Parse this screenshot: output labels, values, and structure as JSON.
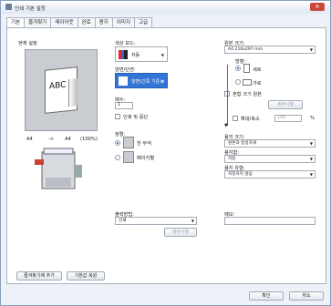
{
  "window": {
    "title": "인쇄 기본 설정",
    "close_label": "✕"
  },
  "tabs": [
    "기본",
    "즐겨찾기",
    "레이아웃",
    "완료",
    "용지",
    "이미지",
    "고급"
  ],
  "left": {
    "current_settings_label": "현재 설정",
    "preview_text": "ABC",
    "paper_row": {
      "from": "A4",
      "arrow": "->",
      "to": "A4",
      "zoom": "(100%)"
    }
  },
  "mid": {
    "color_mode_label": "색상 모드:",
    "color_mode_value": "자동",
    "duplex_label": "양면/단면:",
    "duplex_value": "양면(긴쪽 기준)",
    "copies_label": "매수:",
    "copies_value": "1",
    "collate_label": "인쇄 및 중단",
    "collate_sort_label": "정렬:",
    "collate_opt1": "한 부씩",
    "collate_opt2": "페이지별",
    "output_label": "출력방법:",
    "output_value": "인쇄",
    "detail_button": "세부사항"
  },
  "right": {
    "orig_size_label": "원본 크기:",
    "orig_size_value": "A4 210x297 mm",
    "orientation_label": "방향:",
    "portrait": "세로",
    "landscape": "가로",
    "mixed_label": "혼합 크기 원본",
    "detail_button": "세부사항",
    "zoom_label": "확대/축소",
    "zoom_value": "100",
    "zoom_unit": "%",
    "paper_size_label": "용지 크기:",
    "paper_size_value": "원본과 동일하게",
    "paper_tray_label": "용지함:",
    "paper_tray_value": "자동",
    "paper_type_label": "용지 유형:",
    "paper_type_value": "지정하지 않음",
    "user_label": "메모:"
  },
  "bottom": {
    "add_favorite": "즐겨찾기에 추가",
    "restore_default": "기본값 복원",
    "ok": "확인",
    "cancel": "취소"
  }
}
